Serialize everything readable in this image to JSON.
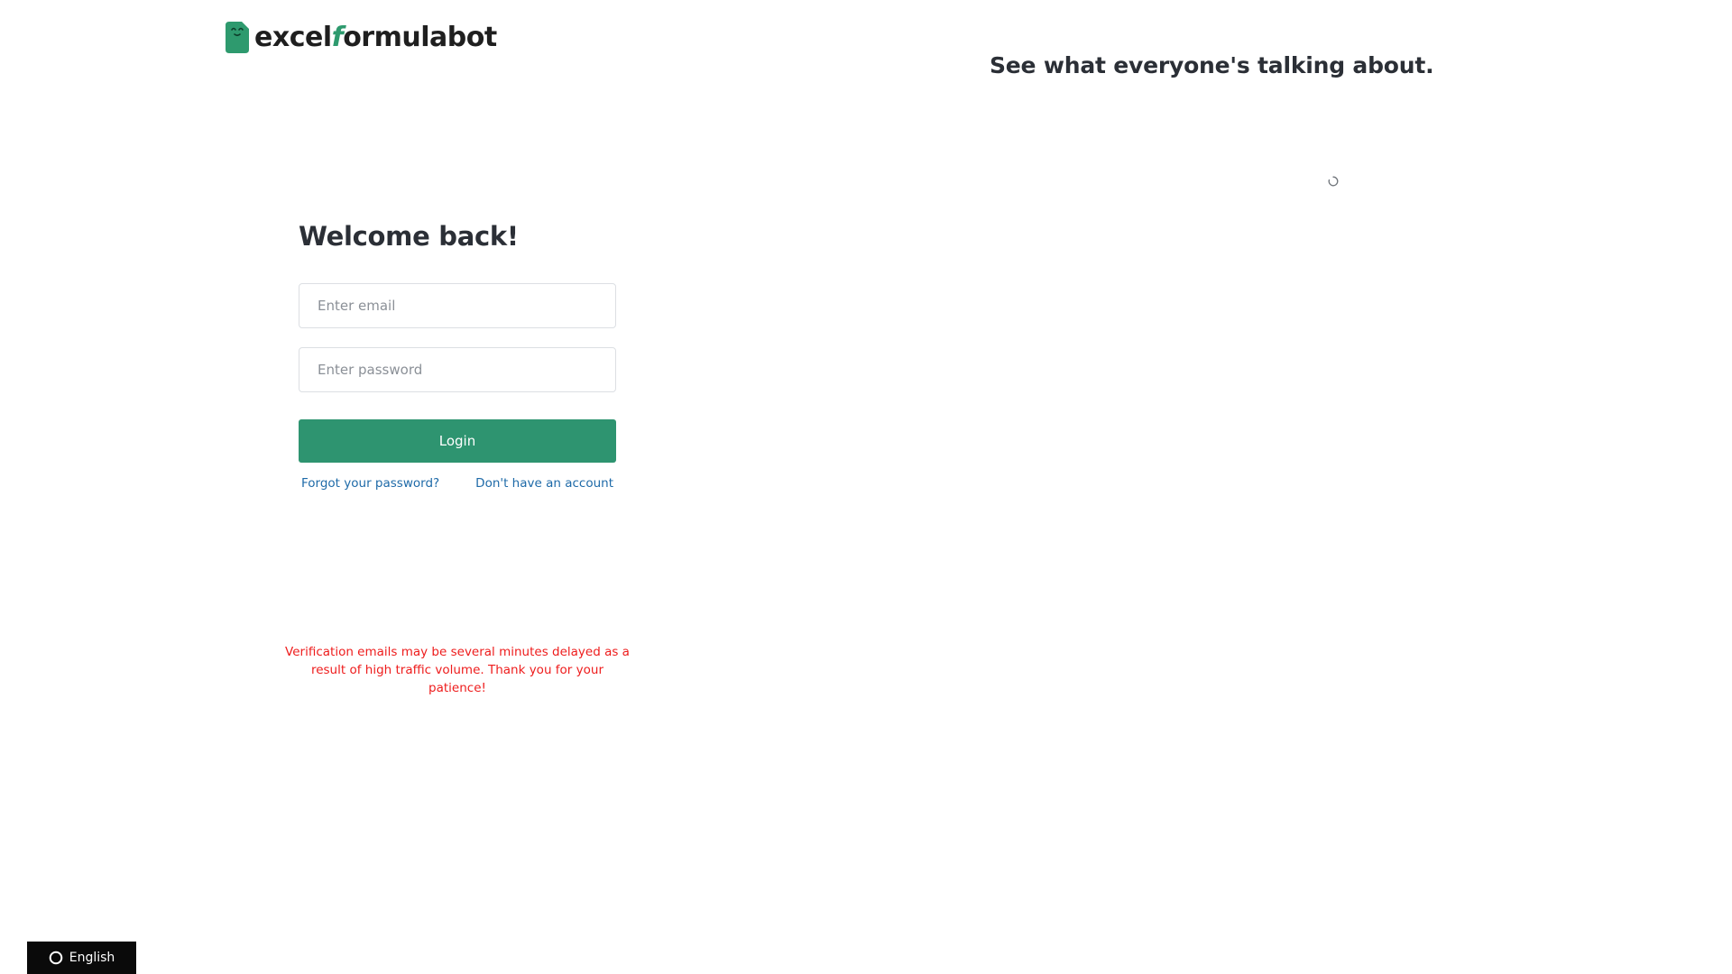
{
  "brand": {
    "logo_text_start": "excel",
    "logo_text_accent": "f",
    "logo_text_end": "ormulabot",
    "accent_color": "#2e9a6e"
  },
  "login": {
    "title": "Welcome back!",
    "email_placeholder": "Enter email",
    "password_placeholder": "Enter password",
    "login_label": "Login",
    "forgot_label": "Forgot your password?",
    "signup_label": "Don't have an account",
    "button_color": "#2e9470",
    "link_color": "#1e6aa8"
  },
  "notice": {
    "text": "Verification emails may be several minutes delayed as a result of high traffic volume. Thank you for your patience!",
    "color": "#ee1c1c"
  },
  "testimonials": {
    "title": "See what everyone's talking about.",
    "loading_icon": "spinner-icon"
  },
  "language": {
    "label": "English",
    "icon": "globe-icon"
  }
}
